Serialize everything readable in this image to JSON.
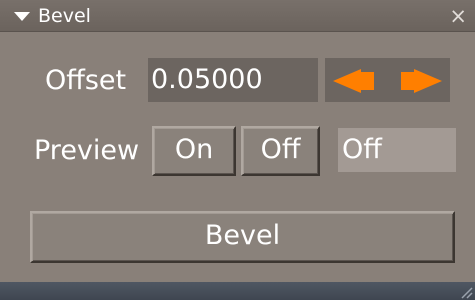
{
  "window": {
    "title": "Bevel",
    "close_glyph": "×"
  },
  "offset": {
    "label": "Offset",
    "value": "0.05000",
    "decrement_icon": "arrow-left-icon",
    "increment_icon": "arrow-right-icon",
    "arrow_color": "#ff7f00"
  },
  "preview": {
    "label": "Preview",
    "on_label": "On",
    "off_label": "Off",
    "status": "Off"
  },
  "actions": {
    "bevel_label": "Bevel"
  },
  "colors": {
    "panel": "#898079",
    "title_bar": "#6b635d",
    "field": "#6c6560",
    "status_field": "#a39a94",
    "bottom_bar": "#4a525d"
  }
}
